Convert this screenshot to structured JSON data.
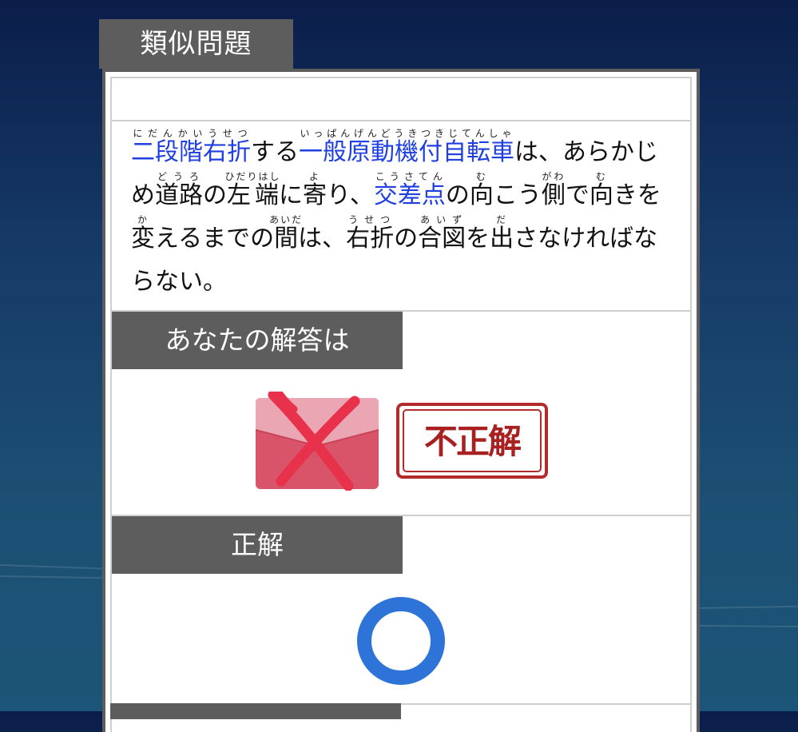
{
  "header": {
    "title": "類似問題"
  },
  "question": {
    "segments": [
      {
        "base": "二段階右折",
        "ruby": "にだんかいうせつ",
        "link": true
      },
      {
        "text": "する"
      },
      {
        "base": "一般原動機付自転車",
        "ruby": "いっぱんげんどうきつきじてんしゃ",
        "link": true
      },
      {
        "text": "は、あらかじめ"
      },
      {
        "base": "道路",
        "ruby": "どうろ"
      },
      {
        "text": "の"
      },
      {
        "base": "左端",
        "ruby": "ひだりはし"
      },
      {
        "text": "に"
      },
      {
        "base": "寄",
        "ruby": "よ"
      },
      {
        "text": "り、"
      },
      {
        "base": "交差点",
        "ruby": "こうさてん",
        "link": true
      },
      {
        "text": "の"
      },
      {
        "base": "向",
        "ruby": "む"
      },
      {
        "text": "こう"
      },
      {
        "base": "側",
        "ruby": "がわ"
      },
      {
        "text": "で"
      },
      {
        "base": "向",
        "ruby": "む"
      },
      {
        "text": "きを"
      },
      {
        "base": "変",
        "ruby": "か"
      },
      {
        "text": "えるまでの"
      },
      {
        "base": "間",
        "ruby": "あいだ"
      },
      {
        "text": "は、"
      },
      {
        "base": "右折",
        "ruby": "うせつ"
      },
      {
        "text": "の"
      },
      {
        "base": "合図",
        "ruby": "あいず"
      },
      {
        "text": "を"
      },
      {
        "base": "出",
        "ruby": "だ"
      },
      {
        "text": "さなければならない。"
      }
    ]
  },
  "your_answer": {
    "label": "あなたの解答は",
    "icon": "cross-envelope-icon",
    "stamp": "不正解"
  },
  "correct_answer": {
    "label": "正解",
    "icon": "circle-icon"
  },
  "colors": {
    "link": "#1f3fe0",
    "stamp": "#b32b2b",
    "circle": "#2e74d8",
    "label_bg": "#5d5d5d"
  }
}
